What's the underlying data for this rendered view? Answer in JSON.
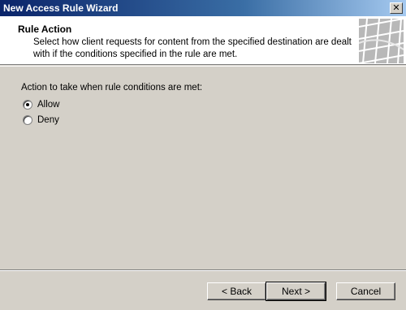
{
  "window": {
    "title": "New Access Rule Wizard",
    "close_label": "✕"
  },
  "header": {
    "title": "Rule Action",
    "description": "Select how client requests for content from the specified destination are dealt with if the conditions specified in the rule are met."
  },
  "main": {
    "question": "Action to take when rule conditions are met:",
    "options": [
      {
        "label": "Allow",
        "checked": true
      },
      {
        "label": "Deny",
        "checked": false
      }
    ]
  },
  "buttons": {
    "back": "< Back",
    "next": "Next >",
    "cancel": "Cancel"
  }
}
